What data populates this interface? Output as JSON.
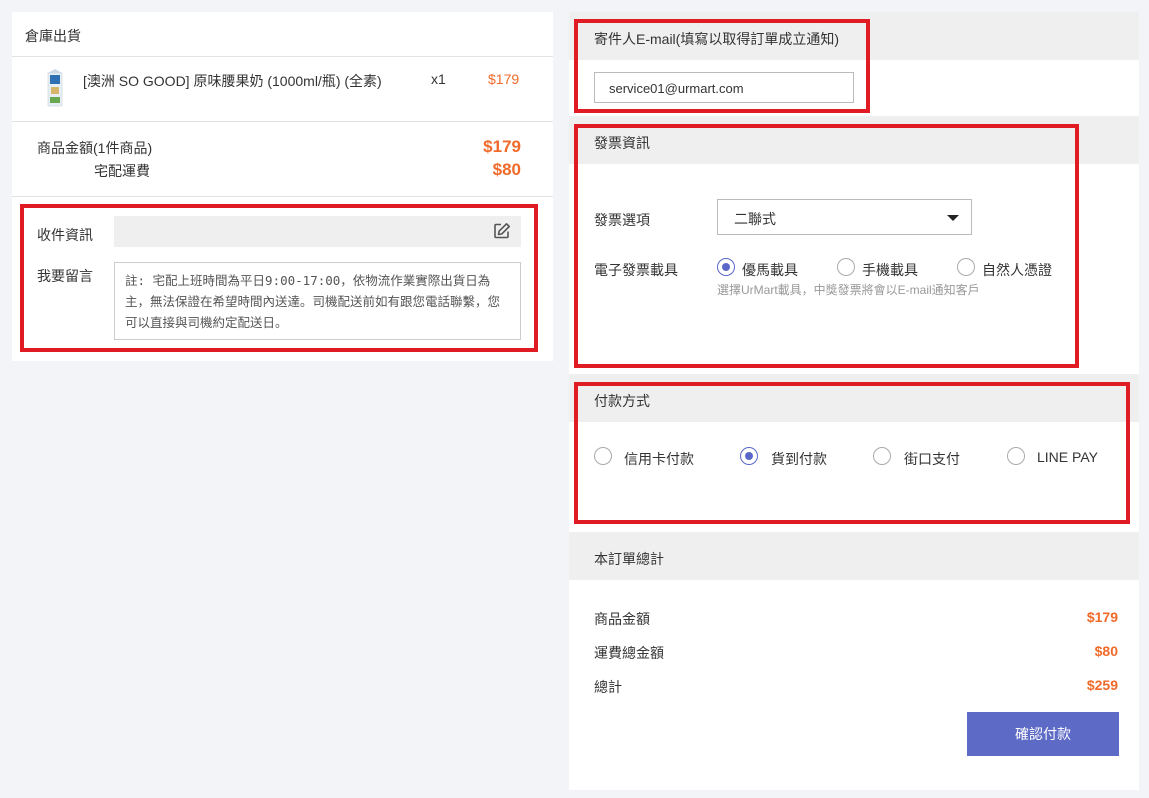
{
  "warehouse": {
    "title": "倉庫出貨",
    "product": {
      "name": "[澳洲 SO GOOD] 原味腰果奶 (1000ml/瓶) (全素)",
      "qty": "x1",
      "price": "$179"
    },
    "summary": {
      "subtotal_label": "商品金額(1件商品)",
      "subtotal_value": "$179",
      "shipping_label": "宅配運費",
      "shipping_value": "$80"
    },
    "recipient_label": "收件資訊",
    "message_label": "我要留言",
    "message_text": "註: 宅配上班時間為平日9:00-17:00，依物流作業實際出貨日為主，無法保證在希望時間內送達。司機配送前如有跟您電話聯繫，您可以直接與司機約定配送日。"
  },
  "email_section": {
    "title": "寄件人E-mail(填寫以取得訂單成立通知)",
    "value": "service01@urmart.com"
  },
  "invoice_section": {
    "title": "發票資訊",
    "option_label": "發票選項",
    "option_value": "二聯式",
    "carrier_label": "電子發票載具",
    "carriers": [
      "優馬載具",
      "手機載具",
      "自然人憑證"
    ],
    "carrier_selected": "優馬載具",
    "carrier_note": "選擇UrMart載具，中獎發票將會以E-mail通知客戶"
  },
  "payment_section": {
    "title": "付款方式",
    "methods": [
      "信用卡付款",
      "貨到付款",
      "街口支付",
      "LINE PAY"
    ],
    "selected": "貨到付款"
  },
  "order_total": {
    "title": "本訂單總計",
    "items_label": "商品金額",
    "items_value": "$179",
    "shipping_label": "運費總金額",
    "shipping_value": "$80",
    "total_label": "總計",
    "total_value": "$259",
    "confirm_label": "確認付款"
  },
  "colors": {
    "accent": "#5d6ac6",
    "price": "#f06a2a",
    "highlight_box": "#e01b24"
  }
}
